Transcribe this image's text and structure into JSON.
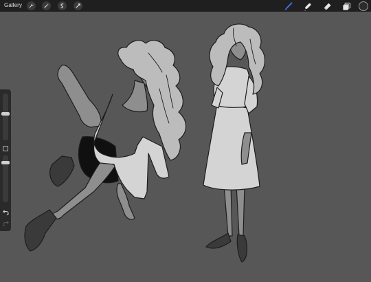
{
  "toolbar": {
    "gallery_label": "Gallery",
    "left_tools": [
      "wrench-icon",
      "magic-wand-icon",
      "selection-icon",
      "transform-icon"
    ],
    "right_tools": [
      "brush-icon",
      "smudge-icon",
      "eraser-icon",
      "layers-icon"
    ],
    "active_tool": "brush-icon",
    "accent_color": "#3d7bff",
    "current_color": "#2c2c2c"
  },
  "sidebar": {
    "brush_size": 0.55,
    "opacity": 0.2,
    "icons": [
      "modify-button",
      "undo-icon",
      "redo-icon"
    ]
  },
  "canvas": {
    "background_color": "#575757",
    "content": "sketch-two-figures"
  }
}
